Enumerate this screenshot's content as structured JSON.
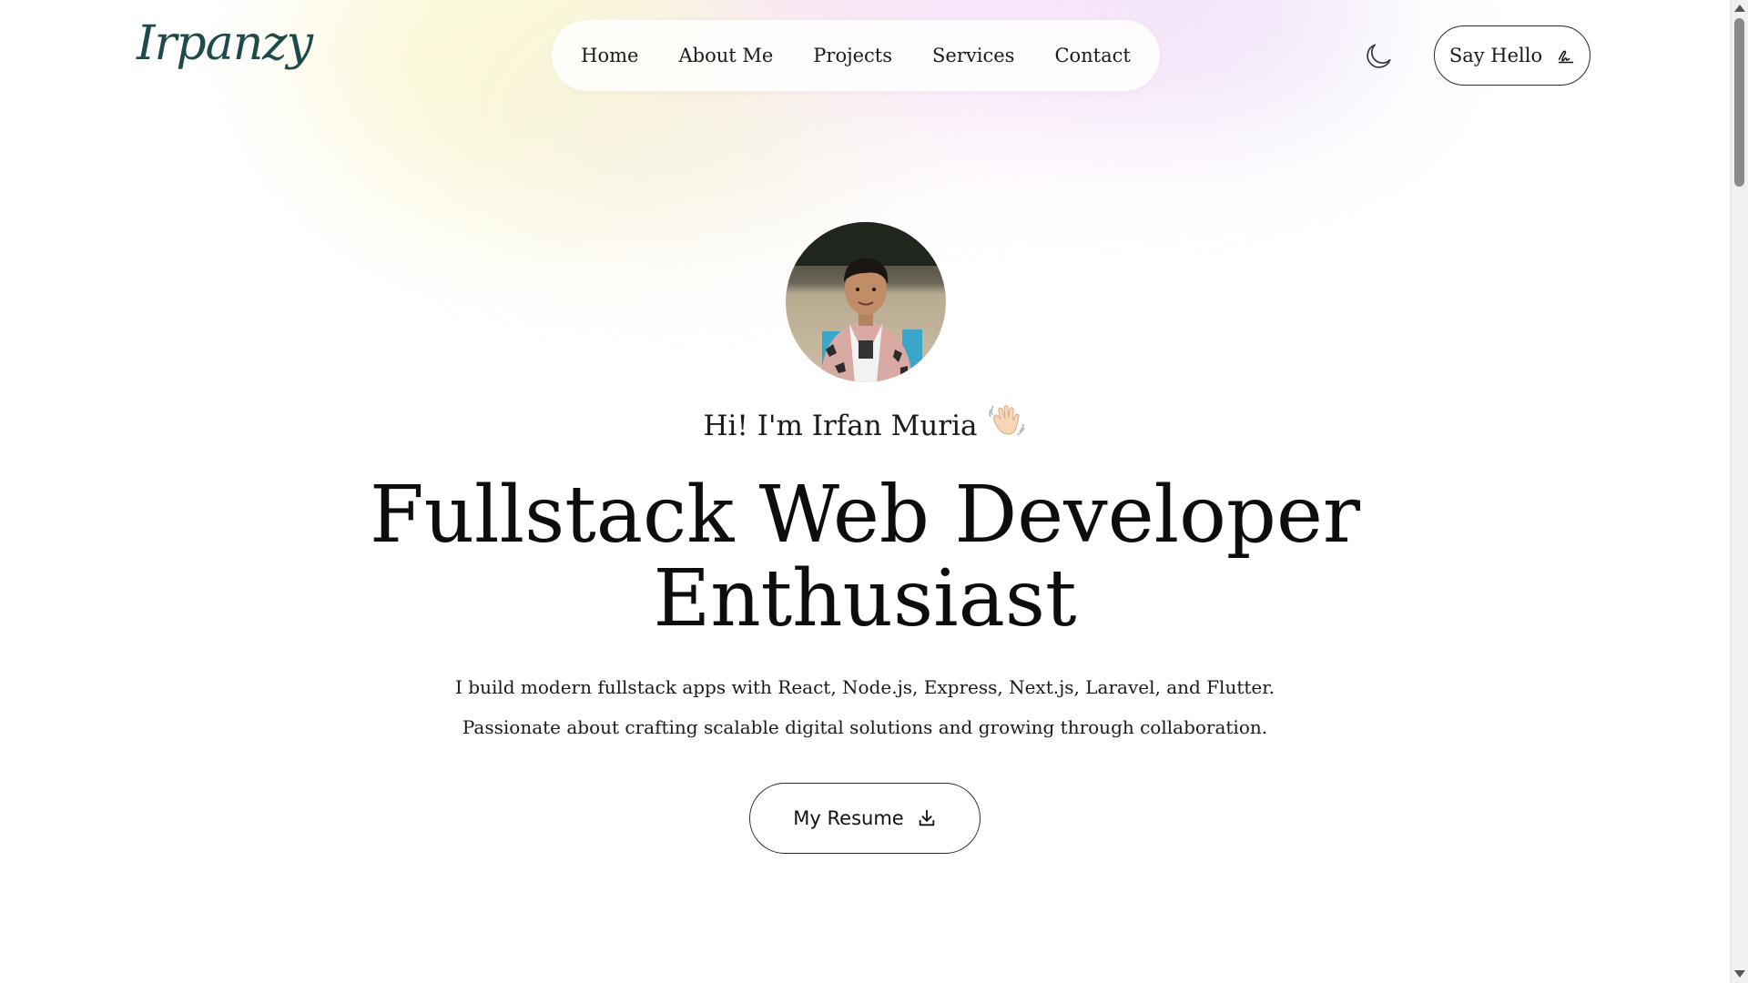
{
  "header": {
    "logo": "Irpanzy",
    "nav": [
      {
        "label": "Home"
      },
      {
        "label": "About Me"
      },
      {
        "label": "Projects"
      },
      {
        "label": "Services"
      },
      {
        "label": "Contact"
      }
    ],
    "theme_toggle_icon": "moon-icon",
    "say_hello": {
      "label": "Say Hello",
      "icon": "signature-icon"
    }
  },
  "hero": {
    "avatar_icon": "profile-photo",
    "greeting": "Hi! I'm Irfan Muria",
    "greeting_emoji_icon": "waving-hand-icon",
    "headline_line1": "Fullstack Web Developer",
    "headline_line2": "Enthusiast",
    "description_line1": "I build modern fullstack apps with React, Node.js, Express, Next.js, Laravel, and Flutter.",
    "description_line2": "Passionate about crafting scalable digital solutions and growing through collaboration.",
    "resume_button": {
      "label": "My Resume",
      "icon": "download-icon"
    }
  },
  "colors": {
    "logo": "#1f4a4a",
    "text": "#111111",
    "background": "#ffffff"
  }
}
